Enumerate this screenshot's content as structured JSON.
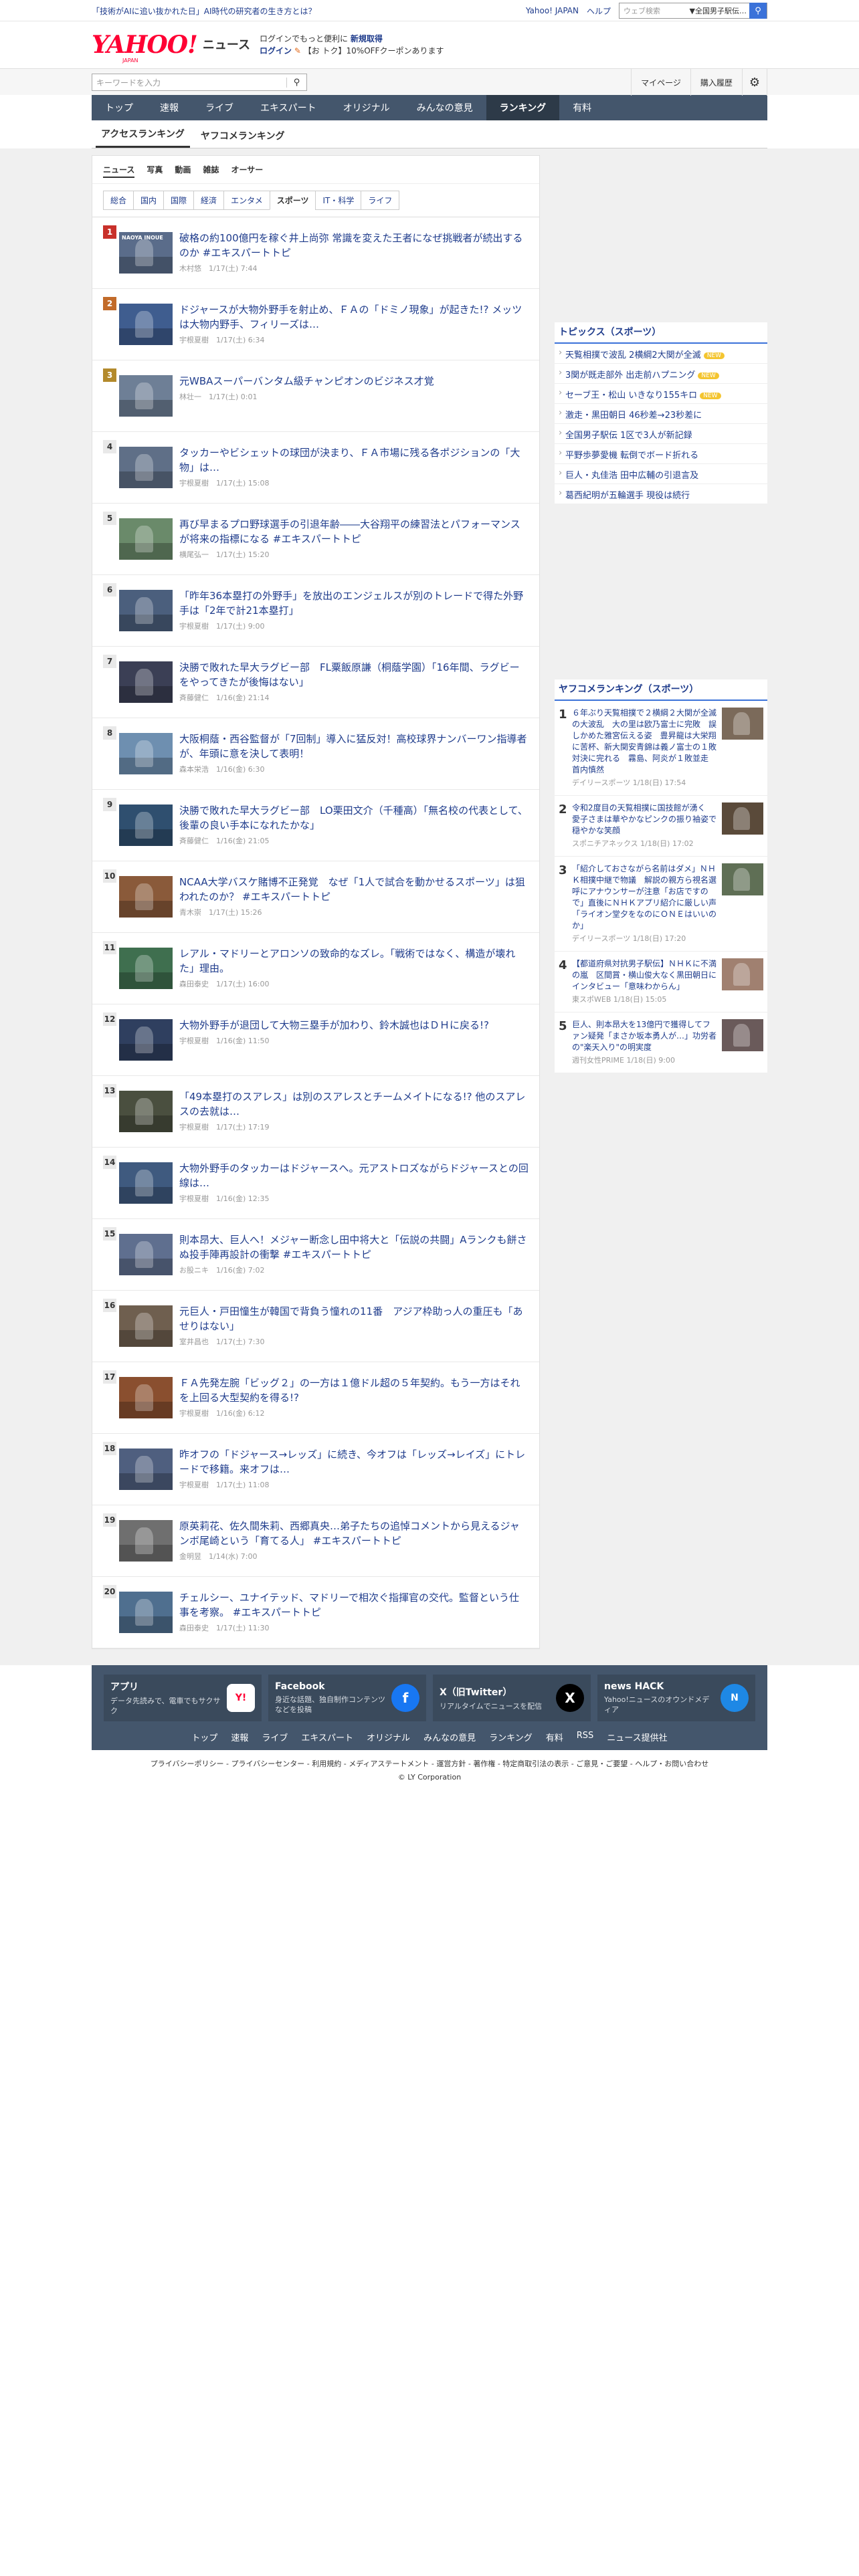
{
  "topbar": {
    "promo": "「技術がAIに追い抜かれた日」AI時代の研究者の生き方とは？",
    "links": [
      "Yahoo! JAPAN",
      "ヘルプ"
    ],
    "search_placeholder": "ウェブ検索",
    "search_scope": "▼全国男子駅伝…"
  },
  "header": {
    "logo": "YAHOO!",
    "logo_sub": "JAPAN",
    "service": "ニュース",
    "promo_line1": "ログインでもっと便利に",
    "promo_line1_bold": "新規取得",
    "promo_login": "ログイン",
    "promo_line2": "【お トク】10%OFFクーポンあります"
  },
  "searchbar": {
    "placeholder": "キーワードを入力",
    "util": [
      "マイページ",
      "購入履歴"
    ]
  },
  "nav": [
    "トップ",
    "速報",
    "ライブ",
    "エキスパート",
    "オリジナル",
    "みんなの意見",
    "ランキング",
    "有料"
  ],
  "subtabs": [
    "アクセスランキング",
    "ヤフコメランキング"
  ],
  "typetabs": [
    "ニュース",
    "写真",
    "動画",
    "雑誌",
    "オーサー"
  ],
  "cattabs": [
    "総合",
    "国内",
    "国際",
    "経済",
    "エンタメ",
    "スポーツ",
    "IT・科学",
    "ライフ"
  ],
  "ranking": [
    {
      "no": "1",
      "title": "破格の約100億円を稼ぐ井上尚弥 常識を変えた王者になぜ挑戦者が続出するのか #エキスパートトピ",
      "meta": "木村悠　1/17(土) 7:44",
      "cap": "NAOYA INOUE"
    },
    {
      "no": "2",
      "title": "ドジャースが大物外野手を射止め、ＦＡの「ドミノ現象」が起きた!? メッツは大物内野手、フィリーズは…",
      "meta": "宇根夏樹　1/17(土) 6:34",
      "cap": ""
    },
    {
      "no": "3",
      "title": "元WBAスーパーバンタム級チャンピオンのビジネス才覚",
      "meta": "林壮一　1/17(土) 0:01",
      "cap": ""
    },
    {
      "no": "4",
      "title": "タッカーやビシェットの球団が決まり、ＦＡ市場に残る各ポジションの「大物」は…",
      "meta": "宇根夏樹　1/17(土) 15:08",
      "cap": ""
    },
    {
      "no": "5",
      "title": "再び早まるプロ野球選手の引退年齢――大谷翔平の練習法とパフォーマンスが将来の指標になる #エキスパートトピ",
      "meta": "横尾弘一　1/17(土) 15:20",
      "cap": ""
    },
    {
      "no": "6",
      "title": "「昨年36本塁打の外野手」を放出のエンジェルスが別のトレードで得た外野手は「2年で計21本塁打」",
      "meta": "宇根夏樹　1/17(土) 9:00",
      "cap": ""
    },
    {
      "no": "7",
      "title": "決勝で敗れた早大ラグビー部　FL粟飯原謙（桐蔭学園）「16年間、ラグビーをやってきたが後悔はない」",
      "meta": "斉藤健仁　1/16(金) 21:14",
      "cap": ""
    },
    {
      "no": "8",
      "title": "大阪桐蔭・西谷監督が「7回制」導入に猛反対！高校球界ナンバーワン指導者が、年頭に意を決して表明！",
      "meta": "森本栄浩　1/16(金) 6:30",
      "cap": ""
    },
    {
      "no": "9",
      "title": "決勝で敗れた早大ラグビー部　LO栗田文介（千種高）「無名校の代表として、後輩の良い手本になれたかな」",
      "meta": "斉藤健仁　1/16(金) 21:05",
      "cap": ""
    },
    {
      "no": "10",
      "title": "NCAA大学バスケ賭博不正発覚　なぜ「1人で試合を動かせるスポーツ」は狙われたのか？ #エキスパートトピ",
      "meta": "青木崇　1/17(土) 15:26",
      "cap": ""
    },
    {
      "no": "11",
      "title": "レアル・マドリーとアロンソの致命的なズレ。「戦術ではなく、構造が壊れた」理由。",
      "meta": "森田泰史　1/17(土) 16:00",
      "cap": ""
    },
    {
      "no": "12",
      "title": "大物外野手が退団して大物三塁手が加わり、鈴木誠也はＤＨに戻る!?",
      "meta": "宇根夏樹　1/16(金) 11:50",
      "cap": ""
    },
    {
      "no": "13",
      "title": "「49本塁打のスアレス」は別のスアレスとチームメイトになる!? 他のスアレスの去就は…",
      "meta": "宇根夏樹　1/17(土) 17:19",
      "cap": ""
    },
    {
      "no": "14",
      "title": "大物外野手のタッカーはドジャースへ。元アストロズながらドジャースとの回線は…",
      "meta": "宇根夏樹　1/16(金) 12:35",
      "cap": ""
    },
    {
      "no": "15",
      "title": "則本昂大、巨人へ！メジャー断念し田中将大と「伝説の共闘」Aランクも餅さぬ投手陣再設計の衝撃 #エキスパートトピ",
      "meta": "お股ニキ　1/16(金) 7:02",
      "cap": ""
    },
    {
      "no": "16",
      "title": "元巨人・戸田憧生が韓国で背負う憧れの11番　アジア枠助っ人の重圧も「あせりはない」",
      "meta": "室井昌也　1/17(土) 7:30",
      "cap": ""
    },
    {
      "no": "17",
      "title": "ＦＡ先発左腕「ビッグ２」の一方は１億ドル超の５年契約。もう一方はそれを上回る大型契約を得る!?",
      "meta": "宇根夏樹　1/16(金) 6:12",
      "cap": ""
    },
    {
      "no": "18",
      "title": "昨オフの「ドジャース→レッズ」に続き、今オフは「レッズ→レイズ」にトレードで移籍。来オフは…",
      "meta": "宇根夏樹　1/17(土) 11:08",
      "cap": ""
    },
    {
      "no": "19",
      "title": "原英莉花、佐久間朱莉、西郷真央…弟子たちの追悼コメントから見えるジャンボ尾崎という「育てる人」 #エキスパートトピ",
      "meta": "金明昱　1/14(水) 7:00",
      "cap": ""
    },
    {
      "no": "20",
      "title": "チェルシー、ユナイテッド、マドリーで相次ぐ指揮官の交代。監督という仕事を考察。 #エキスパートトピ",
      "meta": "森田泰史　1/17(土) 11:30",
      "cap": ""
    }
  ],
  "topics": {
    "heading": "トピックス（スポーツ）",
    "items": [
      {
        "text": "天覧相撲で波乱 2横綱2大関が全滅",
        "new": true
      },
      {
        "text": "3関が既走部外 出走前ハプニング",
        "new": true
      },
      {
        "text": "セーブ王・松山 いきなり155キロ",
        "new": true
      },
      {
        "text": "激走・黒田朝日 46秒差→23秒差に",
        "new": false
      },
      {
        "text": "全国男子駅伝 1区で3人が新記録",
        "new": false
      },
      {
        "text": "平野歩夢愛機 転倒でボード折れる",
        "new": false
      },
      {
        "text": "巨人・丸佳浩 田中広輔の引退言及",
        "new": false
      },
      {
        "text": "葛西紀明が五輪選手 現役は続行",
        "new": false
      }
    ],
    "new_label": "NEW"
  },
  "comment_ranking": {
    "heading": "ヤフコメランキング（スポーツ）",
    "items": [
      {
        "no": "1",
        "text": "６年ぶり天覧相撲で２横綱２大関が全滅の大波乱　大の里は欧乃富士に完敗　誤しかめた雅宮伝える姿　豊昇龍は大栄翔に苦杯、新大関安青錦は義ノ富士の１敗対決に完れる　霧島、阿炎が１敗並走　首内慎然",
        "meta": "デイリースポーツ 1/18(日) 17:54"
      },
      {
        "no": "2",
        "text": "令和2度目の天覧相撲に国技館が湧く　愛子さまは華やかなピンクの振り袖姿で穏やかな笑顔",
        "meta": "スポニチアネックス 1/18(日) 17:02"
      },
      {
        "no": "3",
        "text": "「紹介しておさながら名前はダメ」ＮＨＫ相撲中継で物議　解説の親方ら視名選呼にアナウンサーが注意「お店ですので」直後にＮＨＫアプリ紹介に厳しい声「ライオン堂夕をなのにＯＮＥはいいのか」",
        "meta": "デイリースポーツ 1/18(日) 17:20"
      },
      {
        "no": "4",
        "text": "【都道府県対抗男子駅伝】ＮＨＫに不満の嵐　区間賞・横山俊大なく黒田朝日にインタビュー「意味わからん」",
        "meta": "東スポWEB 1/18(日) 15:05"
      },
      {
        "no": "5",
        "text": "巨人、則本昂大を13億円で獲得してファン疑発「まさか坂本勇人が…」功労者の\"楽天入り\"の明実度",
        "meta": "週刊女性PRIME 1/18(日) 9:00"
      }
    ]
  },
  "footer": {
    "cards": [
      {
        "title": "アプリ",
        "desc": "データ先読みで、電車でもサクサク",
        "icon": "Y!"
      },
      {
        "title": "Facebook",
        "desc": "身近な話題、独自制作コンテンツなどを投稿",
        "icon": "f"
      },
      {
        "title": "X（旧Twitter）",
        "desc": "リアルタイムでニュースを配信",
        "icon": "X"
      },
      {
        "title": "news HACK",
        "desc": "Yahoo!ニュースのオウンドメディア",
        "icon": "N"
      }
    ],
    "links": [
      "トップ",
      "速報",
      "ライブ",
      "エキスパート",
      "オリジナル",
      "みんなの意見",
      "ランキング",
      "有料",
      "RSS",
      "ニュース提供社"
    ],
    "legal": "プライバシーポリシー - プライバシーセンター - 利用規約 - メディアステートメント - 運営方針 - 著作権 - 特定商取引法の表示 - ご意見・ご要望 - ヘルプ・お問い合わせ",
    "copyright": "© LY Corporation"
  },
  "colors": {
    "accent": "#1f3c8c",
    "nav_bg": "#44566c",
    "rank1": "#c8302a",
    "rank2": "#c26b2a",
    "rank3": "#b38a2c"
  }
}
